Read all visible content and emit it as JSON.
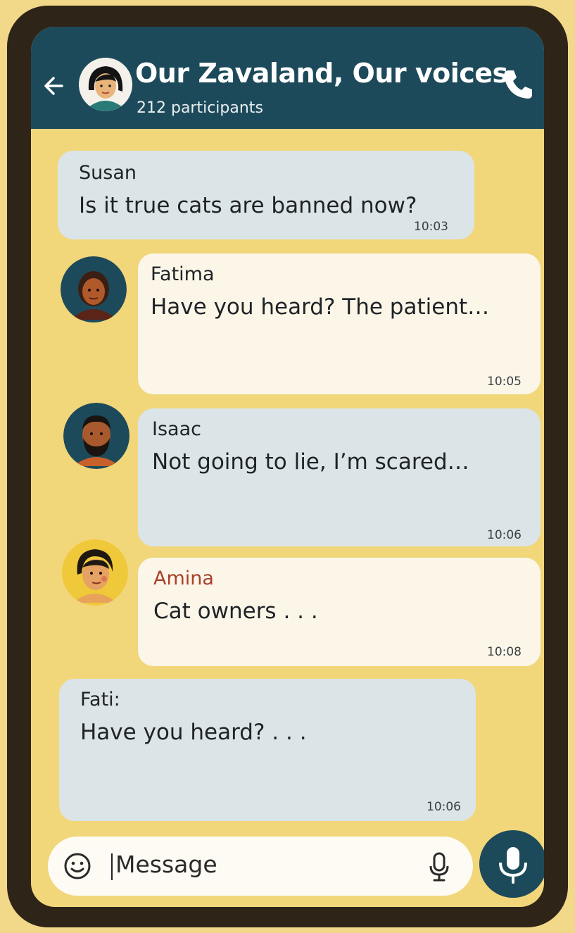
{
  "header": {
    "title": "Our Zavaland, Our voices",
    "participants": "212 participants"
  },
  "messages": [
    {
      "sender": "Susan",
      "text": "Is it true cats are banned now?",
      "time": "10:03"
    },
    {
      "sender": "Fatima",
      "text": "Have you heard? The patient…",
      "time": "10:05"
    },
    {
      "sender": "Isaac",
      "text": "Not going to lie, I’m scared…",
      "time": "10:06"
    },
    {
      "sender": "Amina",
      "text": "Cat owners . . .",
      "time": "10:08"
    },
    {
      "sender": "Fati:",
      "text": "Have you heard? . . .",
      "time": "10:06"
    }
  ],
  "composer": {
    "placeholder": "Message"
  },
  "icons": {
    "back": "back-arrow-icon",
    "call": "phone-icon",
    "emoji": "smiley-icon",
    "mic": "microphone-icon"
  },
  "colors": {
    "background": "#f2d98a",
    "screen": "#f2d67a",
    "header": "#1d4a5a",
    "bubble_blue": "#dbe4e7",
    "bubble_cream": "#fbf6e8",
    "accent_name": "#a8412b"
  }
}
